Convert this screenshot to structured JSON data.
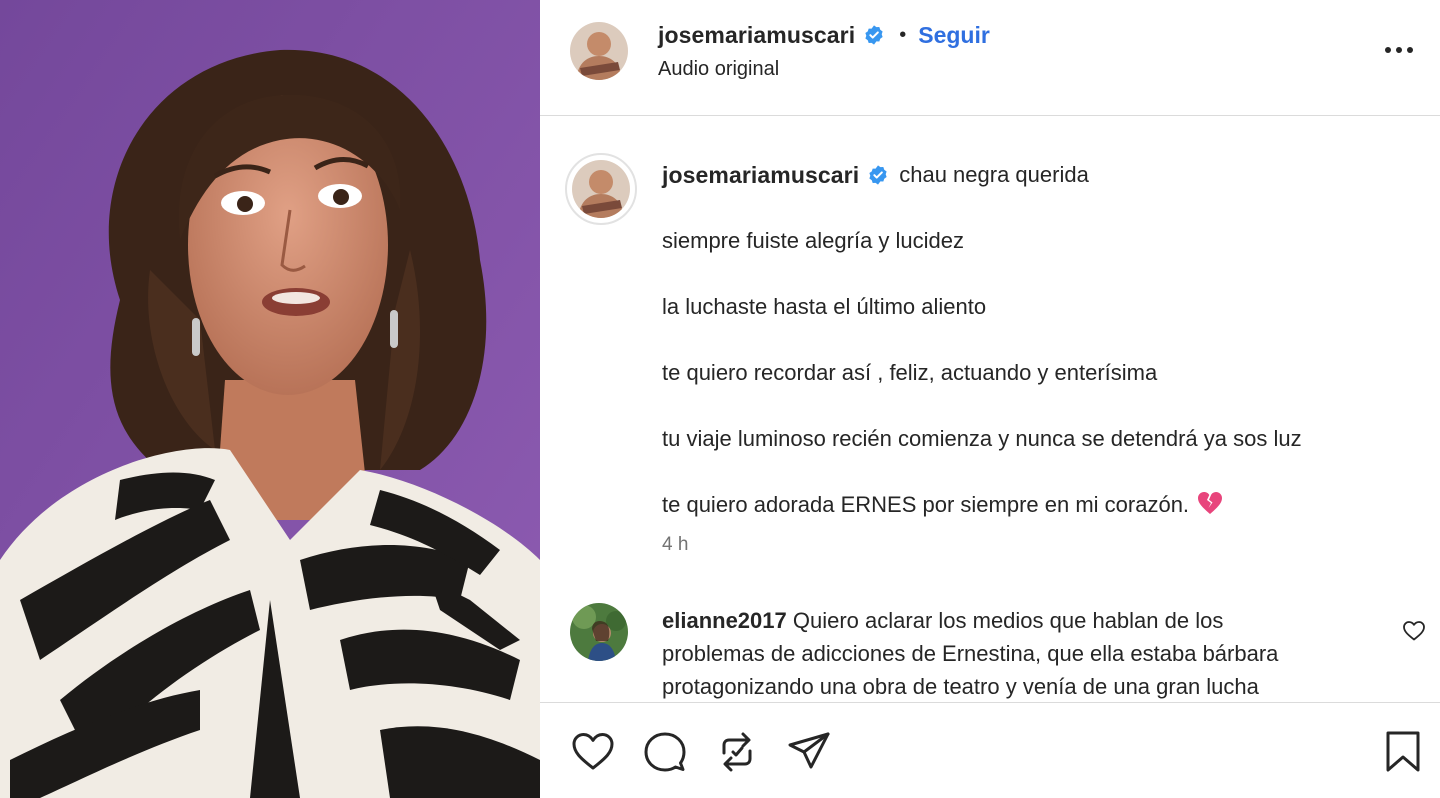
{
  "post": {
    "username": "josemariamuscari",
    "follow_label": "Seguir",
    "separator": "•",
    "audio_label": "Audio original",
    "verified": true
  },
  "caption": {
    "username": "josemariamuscari",
    "lines": [
      "chau negra querida",
      "siempre fuiste alegría y lucidez",
      "la luchaste hasta el último aliento",
      "te quiero recordar así , feliz, actuando y enterísima",
      "tu viaje luminoso recién comienza y nunca se detendrá ya sos luz",
      "te quiero adorada ERNES por siempre en mi corazón."
    ],
    "emoji": "broken-heart",
    "timestamp": "4 h"
  },
  "comment": {
    "username": "elianne2017",
    "lines": [
      "Quiero aclarar los medios que hablan de los",
      "problemas de adicciones de Ernestina, que ella estaba bárbara",
      "protagonizando una obra de teatro y venía de una gran lucha"
    ]
  },
  "actions": {
    "icons": [
      "heart-icon",
      "comment-icon",
      "repost-icon",
      "share-icon",
      "bookmark-icon"
    ]
  },
  "colors": {
    "accent": "#2f6fe0",
    "verified": "#3897f0",
    "media_background": "#8654ab",
    "broken_heart": "#e8457c"
  }
}
